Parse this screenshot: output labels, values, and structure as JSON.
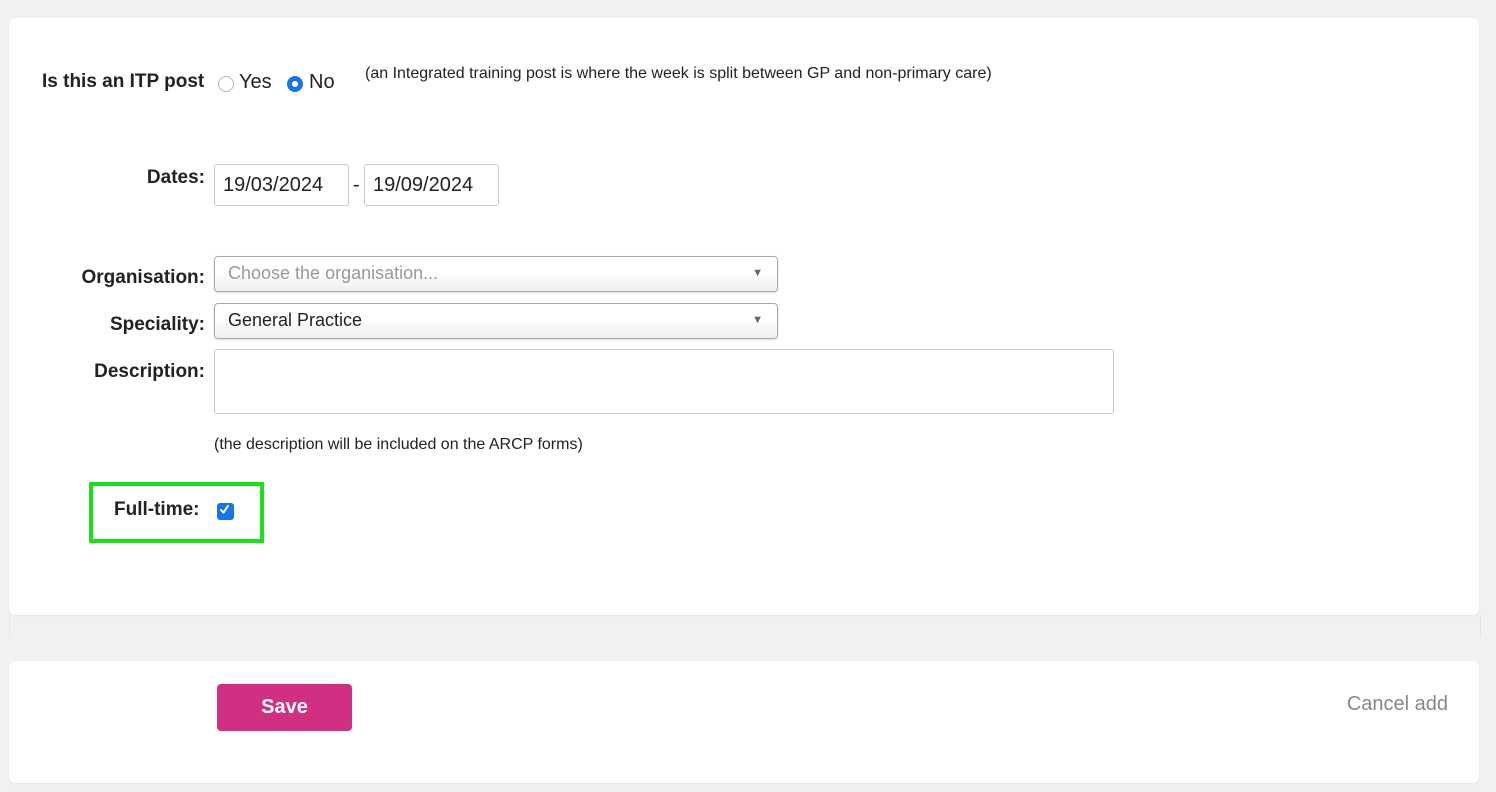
{
  "itp": {
    "label": "Is this an ITP post",
    "options": [
      {
        "label": "Yes",
        "selected": false
      },
      {
        "label": "No",
        "selected": true
      }
    ],
    "note": "(an Integrated training post is where the week is split between GP and non-primary care)"
  },
  "dates": {
    "label": "Dates:",
    "start": "19/03/2024",
    "separator": "-",
    "end": "19/09/2024"
  },
  "organisation": {
    "label": "Organisation:",
    "placeholder": "Choose the organisation..."
  },
  "speciality": {
    "label": "Speciality:",
    "value": "General Practice"
  },
  "description": {
    "label": "Description:",
    "value": "",
    "note": "(the description will be included on the ARCP forms)"
  },
  "fulltime": {
    "label": "Full-time:",
    "checked": true
  },
  "footer": {
    "save_label": "Save",
    "cancel_label": "Cancel add"
  },
  "colors": {
    "accent": "#1a73e8",
    "save": "#d12f82",
    "highlight": "#19e019"
  }
}
